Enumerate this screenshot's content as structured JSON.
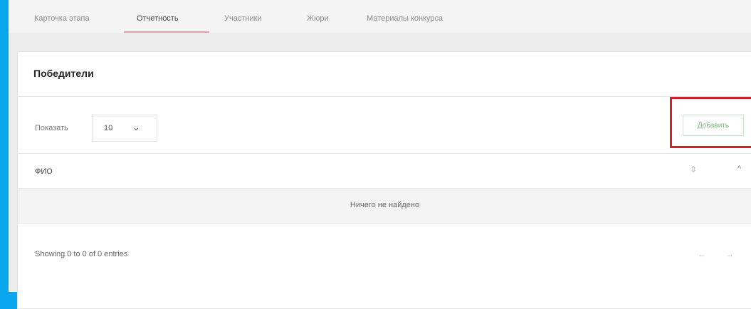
{
  "tabs": [
    {
      "label": "Карточка этапа"
    },
    {
      "label": "Отчетность"
    },
    {
      "label": "Участники"
    },
    {
      "label": "Жюри"
    },
    {
      "label": "Материалы конкурса"
    }
  ],
  "active_tab": "Отчетность",
  "card": {
    "title": "Победители",
    "show_label": "Показать",
    "page_size": "10",
    "add_label": "Добавить",
    "column_header": "ФИО",
    "empty_message": "Ничего не найдено",
    "entries_info": "Showing 0 to 0 of 0 entries"
  },
  "icons": {
    "select_chevron": "chevron-down-icon",
    "sort": "sort-icon",
    "collapse": "chevron-up-icon",
    "prev": "arrow-left-icon",
    "next": "arrow-right-icon"
  },
  "colors": {
    "frame": "#0aa6ee",
    "highlight": "#d0202a",
    "add_button_text": "#7ab87a",
    "active_tab_underline": "#e8a0a8"
  }
}
